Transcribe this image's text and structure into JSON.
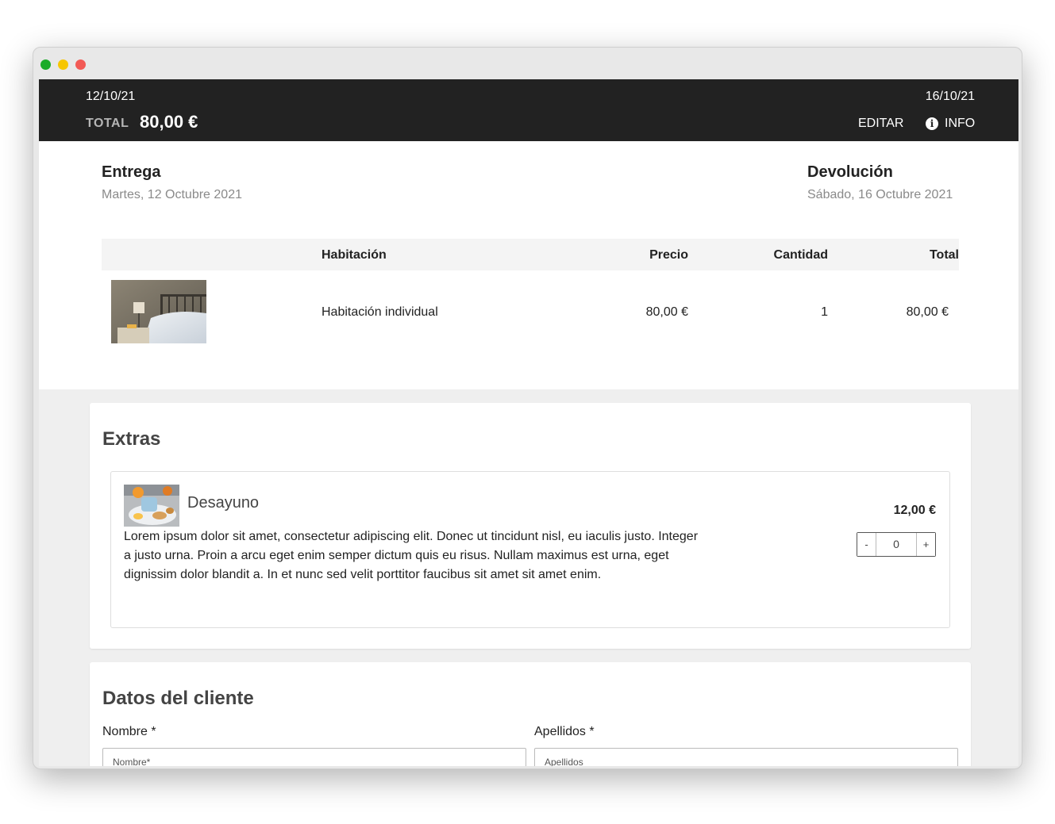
{
  "window": {
    "controls": [
      "green",
      "yellow",
      "red"
    ]
  },
  "topbar": {
    "start_date": "12/10/21",
    "end_date": "16/10/21",
    "total_label": "TOTAL",
    "total_value": "80,00 €",
    "edit_label": "EDITAR",
    "info_label": "INFO",
    "info_icon": "info-circle-icon"
  },
  "delivery": {
    "title": "Entrega",
    "date": "Martes, 12 Octubre 2021"
  },
  "return": {
    "title": "Devolución",
    "date": "Sábado, 16 Octubre 2021"
  },
  "table": {
    "headers": {
      "room": "Habitación",
      "price": "Precio",
      "quantity": "Cantidad",
      "total": "Total"
    },
    "rows": [
      {
        "room": "Habitación individual",
        "price": "80,00 €",
        "quantity": "1",
        "total": "80,00 €"
      }
    ]
  },
  "extras": {
    "title": "Extras",
    "items": [
      {
        "name": "Desayuno",
        "description": "Lorem ipsum dolor sit amet, consectetur adipiscing elit. Donec ut tincidunt nisl, eu iaculis justo. Integer a justo urna. Proin a arcu eget enim semper dictum quis eu risus. Nullam maximus est urna, eget dignissim dolor blandit a. In et nunc sed velit porttitor faucibus sit amet sit amet enim.",
        "price": "12,00 €",
        "minus": "-",
        "quantity": "0",
        "plus": "+"
      }
    ]
  },
  "client": {
    "title": "Datos del cliente",
    "first_name_label": "Nombre *",
    "first_name_placeholder": "Nombre*",
    "last_name_label": "Apellidos *",
    "last_name_placeholder": "Apellidos"
  },
  "colors": {
    "topbar_bg": "#222222",
    "page_bg": "#efefef",
    "muted_text": "#8a8a8a"
  }
}
